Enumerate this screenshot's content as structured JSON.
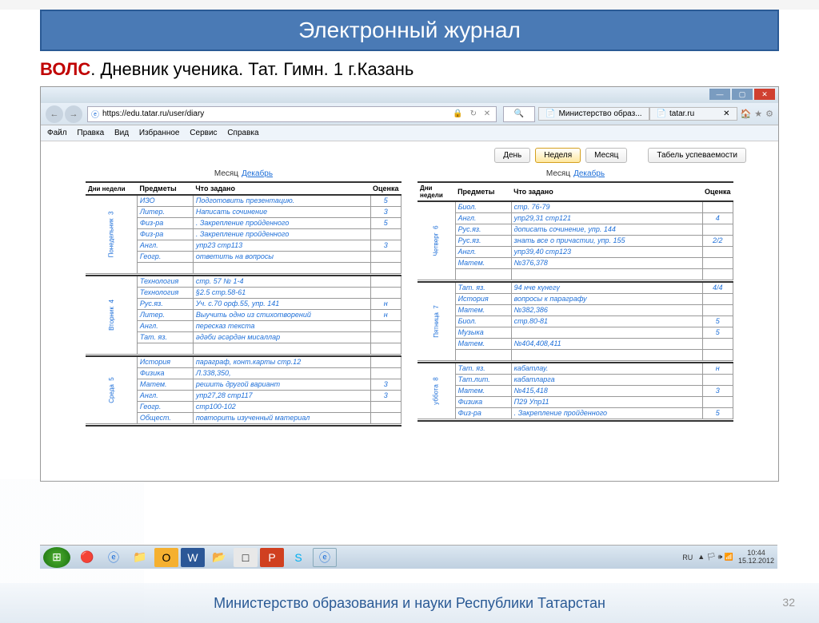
{
  "header": {
    "title": "Электронный журнал"
  },
  "subtitle": {
    "red": "ВОЛС",
    "rest": ".  Дневник ученика. Тат. Гимн. 1  г.Казань"
  },
  "browser": {
    "url": "https://edu.tatar.ru/user/diary",
    "tabs": [
      {
        "icon": "📄",
        "label": "Министерство образ..."
      },
      {
        "icon": "📄",
        "label": "tatar.ru"
      }
    ],
    "menu": [
      "Файл",
      "Правка",
      "Вид",
      "Избранное",
      "Сервис",
      "Справка"
    ]
  },
  "topbuttons": {
    "day": "День",
    "week": "Неделя",
    "month": "Месяц",
    "report": "Табель успеваемости"
  },
  "diary": {
    "month_label": "Месяц",
    "month_value": "Декабрь",
    "headers": {
      "day": "Дни недели",
      "subj": "Предметы",
      "task": "Что задано",
      "grade": "Оценка"
    },
    "left": [
      {
        "day": "Понедельник",
        "num": "3",
        "rows": [
          {
            "s": "ИЗО",
            "t": "Подготовить презентацию.",
            "g": "5"
          },
          {
            "s": "Литер.",
            "t": "Написать сочинение",
            "g": "3"
          },
          {
            "s": "Физ-ра",
            "t": ". Закрепление пройденного",
            "g": "5"
          },
          {
            "s": "Физ-ра",
            "t": ". Закрепление пройденного",
            "g": ""
          },
          {
            "s": "Англ.",
            "t": "упр23 стр113",
            "g": "3"
          },
          {
            "s": "Геогр.",
            "t": "ответить на вопросы",
            "g": ""
          },
          {
            "s": "",
            "t": "",
            "g": ""
          }
        ]
      },
      {
        "day": "Вторник",
        "num": "4",
        "rows": [
          {
            "s": "Технология",
            "t": "стр. 57 № 1-4",
            "g": ""
          },
          {
            "s": "Технология",
            "t": "§2.5 стр.58-61",
            "g": ""
          },
          {
            "s": "Рус.яз.",
            "t": "Уч. с.70 орф.55, упр. 141",
            "g": "н"
          },
          {
            "s": "Литер.",
            "t": "Выучить одно из стихотворений",
            "g": "н"
          },
          {
            "s": "Англ.",
            "t": "пересказ текста",
            "g": ""
          },
          {
            "s": "Тат. яз.",
            "t": "әдәби әсәрдән мисаллар",
            "g": ""
          },
          {
            "s": "",
            "t": "",
            "g": ""
          }
        ]
      },
      {
        "day": "Среда",
        "num": "5",
        "rows": [
          {
            "s": "История",
            "t": "параграф, конт.карты стр.12",
            "g": ""
          },
          {
            "s": "Физика",
            "t": "Л.338,350,",
            "g": ""
          },
          {
            "s": "Матем.",
            "t": "решить другой вариант",
            "g": "3"
          },
          {
            "s": "Англ.",
            "t": "упр27,28 стр117",
            "g": "3"
          },
          {
            "s": "Геогр.",
            "t": "стр100-102",
            "g": ""
          },
          {
            "s": "Общест.",
            "t": "повторить изученный материал",
            "g": ""
          }
        ]
      }
    ],
    "right": [
      {
        "day": "Четверг",
        "num": "6",
        "rows": [
          {
            "s": "Биол.",
            "t": "стр. 76-79",
            "g": ""
          },
          {
            "s": "Англ.",
            "t": "упр29,31 стр121",
            "g": "4"
          },
          {
            "s": "Рус.яз.",
            "t": "дописать сочинение, упр. 144",
            "g": ""
          },
          {
            "s": "Рус.яз.",
            "t": "знать все о причастии, упр. 155",
            "g": "2/2"
          },
          {
            "s": "Англ.",
            "t": "упр39,40 стр123",
            "g": ""
          },
          {
            "s": "Матем.",
            "t": "№376,378",
            "g": ""
          },
          {
            "s": "",
            "t": "",
            "g": ""
          }
        ]
      },
      {
        "day": "Пятница",
        "num": "7",
        "rows": [
          {
            "s": "Тат. яз.",
            "t": "94 нче күнегү",
            "g": "4/4"
          },
          {
            "s": "История",
            "t": "вопросы к параграфу",
            "g": ""
          },
          {
            "s": "Матем.",
            "t": "№382,386",
            "g": ""
          },
          {
            "s": "Биол.",
            "t": "стр.80-81",
            "g": "5"
          },
          {
            "s": "Музыка",
            "t": "",
            "g": "5"
          },
          {
            "s": "Матем.",
            "t": "№404,408,411",
            "g": ""
          },
          {
            "s": "",
            "t": "",
            "g": ""
          }
        ]
      },
      {
        "day": "уббота",
        "num": "8",
        "rows": [
          {
            "s": "Тат. яз.",
            "t": "кабатлау.",
            "g": "н"
          },
          {
            "s": "Тат.лит.",
            "t": "кабатларга",
            "g": ""
          },
          {
            "s": "Матем.",
            "t": "№415,418",
            "g": "3"
          },
          {
            "s": "Физика",
            "t": "П29 Упр11",
            "g": ""
          },
          {
            "s": "Физ-ра",
            "t": ". Закрепление пройденного",
            "g": "5"
          }
        ]
      }
    ]
  },
  "tray": {
    "lang": "RU",
    "time": "10:44",
    "date": "15.12.2012"
  },
  "footer": "Министерство образования и науки Республики Татарстан",
  "pagenum": "32"
}
